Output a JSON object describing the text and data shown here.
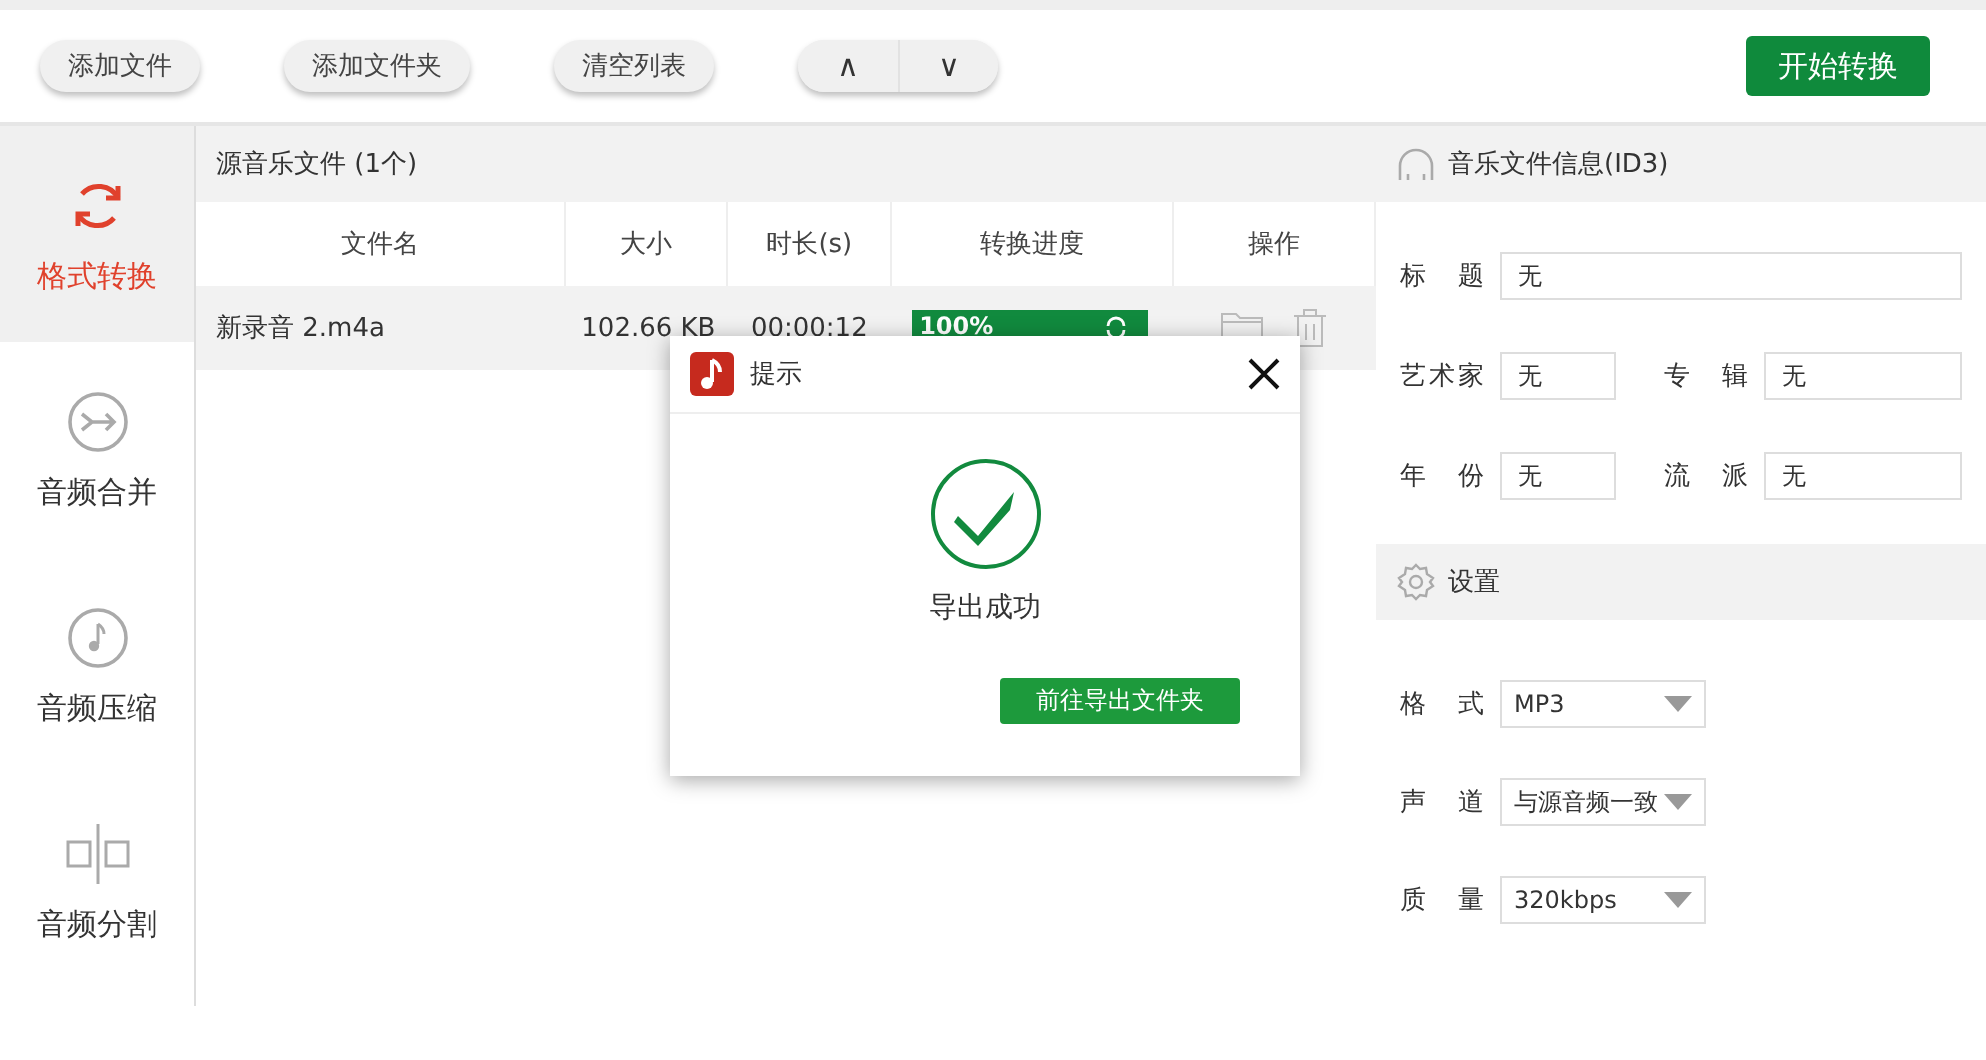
{
  "toolbar": {
    "buttons": [
      {
        "label": "添加文件"
      },
      {
        "label": "添加文件夹"
      },
      {
        "label": "清空列表"
      }
    ],
    "order_buttons": [
      {
        "label": "∧"
      },
      {
        "label": "∨"
      }
    ],
    "start_button": "开始转换"
  },
  "sidebar": {
    "items": [
      {
        "label": "格式转换",
        "kind": "convert",
        "selected": true
      },
      {
        "label": "音频合并",
        "kind": "merge",
        "selected": false
      },
      {
        "label": "音频压缩",
        "kind": "compress",
        "selected": false
      },
      {
        "label": "音频分割",
        "kind": "split",
        "selected": false
      }
    ]
  },
  "file_list": {
    "title": "源音乐文件 (1个)",
    "columns": [
      "文件名",
      "大小",
      "时长(s)",
      "转换进度",
      "操作"
    ],
    "rows": [
      {
        "name": "新录音 2.m4a",
        "size": "102.66 KB",
        "duration": "00:00:12",
        "progress_text": "100%",
        "level": 1
      }
    ]
  },
  "id3": {
    "title": "音乐文件信息(ID3)",
    "rows": [
      [
        {
          "label": "标题",
          "value": "无"
        }
      ],
      [
        {
          "label": "艺术家",
          "value": "无"
        },
        {
          "label": "专辑",
          "value": "无"
        }
      ],
      [
        {
          "label": "年份",
          "value": "无"
        },
        {
          "label": "流派",
          "value": "无"
        }
      ]
    ]
  },
  "settings": {
    "title": "设置",
    "fields": [
      {
        "label": "格式",
        "value": "MP3"
      },
      {
        "label": "声道",
        "value": "与源音频一致"
      },
      {
        "label": "质量",
        "value": "320kbps"
      }
    ]
  },
  "dialog": {
    "title": "提示",
    "message": "导出成功",
    "button": "前往导出文件夹"
  }
}
